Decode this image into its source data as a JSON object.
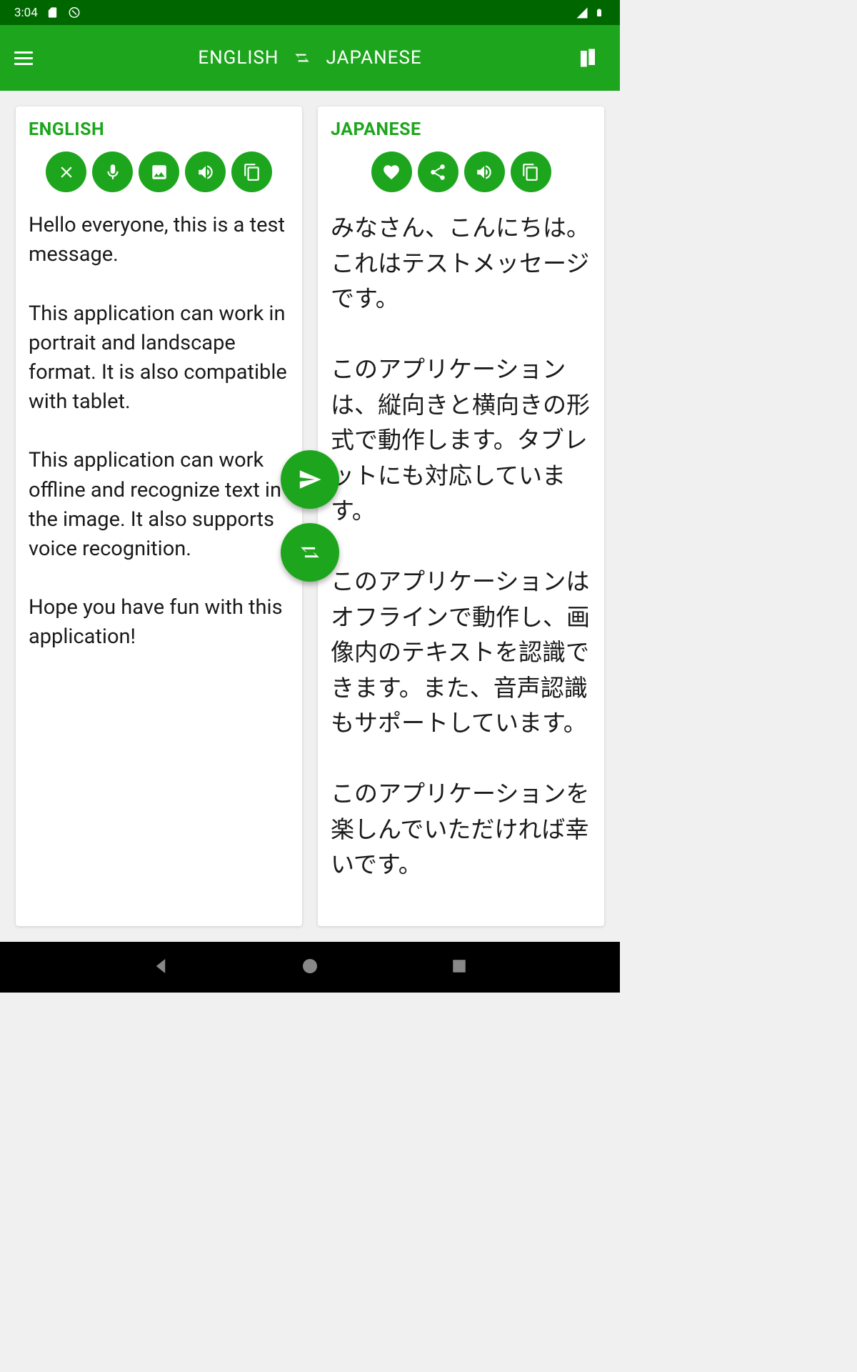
{
  "status": {
    "time": "3:04"
  },
  "header": {
    "source_lang": "ENGLISH",
    "target_lang": "JAPANESE"
  },
  "source_card": {
    "title": "ENGLISH",
    "text": "Hello everyone, this is a test message.\n\nThis application can work in portrait and landscape format. It is also compatible with tablet.\n\nThis application can work offline and recognize text in the image. It also supports voice recognition.\n\nHope you have fun with this application!"
  },
  "target_card": {
    "title": "JAPANESE",
    "text": "みなさん、こんにちは。これはテストメッセージです。\n\nこのアプリケーションは、縦向きと横向きの形式で動作します。タブレットにも対応しています。\n\nこのアプリケーションはオフラインで動作し、画像内のテキストを認識できます。また、音声認識もサポートしています。\n\nこのアプリケーションを楽しんでいただければ幸いです。"
  }
}
